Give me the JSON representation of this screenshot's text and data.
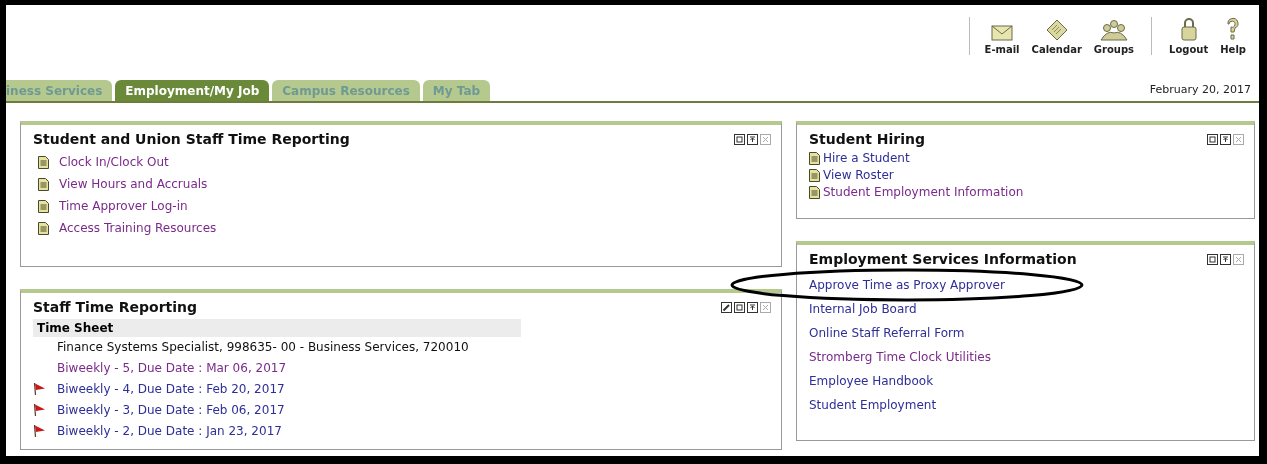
{
  "toolbar": [
    {
      "label": "E-mail",
      "kind": "mail"
    },
    {
      "label": "Calendar",
      "kind": "calendar"
    },
    {
      "label": "Groups",
      "kind": "groups"
    },
    {
      "label": "Logout",
      "kind": "lock"
    },
    {
      "label": "Help",
      "kind": "help"
    }
  ],
  "tabs": [
    {
      "label": "iness Services",
      "selected": false
    },
    {
      "label": "Employment/My Job",
      "selected": true
    },
    {
      "label": "Campus Resources",
      "selected": false
    },
    {
      "label": "My Tab",
      "selected": false
    }
  ],
  "date": "February 20, 2017",
  "left_panels": [
    {
      "title": "Student and Union Staff Time Reporting",
      "kind": "links",
      "doc_icons": true,
      "compact": false,
      "editable": false,
      "links": [
        {
          "text": "Clock In/Clock Out",
          "visited": true
        },
        {
          "text": "View Hours and Accruals",
          "visited": true
        },
        {
          "text": "Time Approver Log-in",
          "visited": true
        },
        {
          "text": "Access Training Resources",
          "visited": true
        }
      ]
    },
    {
      "title": "Staff Time Reporting",
      "kind": "timesheet",
      "editable": true,
      "section": "Time Sheet",
      "job": "Finance Systems Specialist,  998635- 00  -  Business Services, 720010",
      "entries": [
        {
          "text": "Biweekly - 5, Due Date : Mar 06, 2017",
          "flagged": false,
          "visited": true
        },
        {
          "text": "Biweekly - 4, Due Date : Feb 20, 2017",
          "flagged": true,
          "visited": false
        },
        {
          "text": "Biweekly - 3, Due Date : Feb 06, 2017",
          "flagged": true,
          "visited": false
        },
        {
          "text": "Biweekly - 2, Due Date : Jan 23, 2017",
          "flagged": true,
          "visited": false
        }
      ]
    }
  ],
  "right_panels": [
    {
      "title": "Student Hiring",
      "kind": "links",
      "doc_icons": true,
      "compact": true,
      "editable": false,
      "links": [
        {
          "text": "Hire a Student",
          "visited": false
        },
        {
          "text": "View Roster",
          "visited": false
        },
        {
          "text": "Student Employment Information",
          "visited": true
        }
      ]
    },
    {
      "title": "Employment Services Information",
      "kind": "links",
      "doc_icons": false,
      "compact": false,
      "editable": false,
      "links": [
        {
          "text": "Approve Time as Proxy Approver",
          "visited": false
        },
        {
          "text": "Internal Job Board",
          "visited": false
        },
        {
          "text": "Online Staff Referral Form",
          "visited": false
        },
        {
          "text": "Stromberg Time Clock Utilities",
          "visited": true
        },
        {
          "text": "Employee Handbook",
          "visited": false
        },
        {
          "text": "Student Employment",
          "visited": false
        }
      ]
    }
  ]
}
